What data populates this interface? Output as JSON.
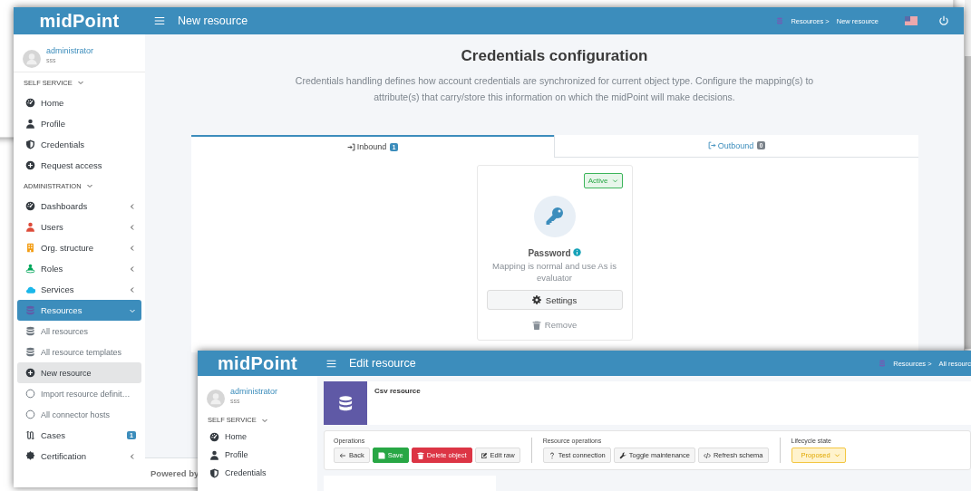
{
  "main_window": {
    "logo": "midPoint",
    "title": "New resource",
    "breadcrumb": {
      "parent": "Resources >",
      "current": "New resource"
    },
    "sidebar": {
      "user": {
        "name": "administrator",
        "subtitle": "sss"
      },
      "sections": [
        {
          "title": "SELF SERVICE",
          "expanded": true,
          "items": [
            {
              "label": "Home",
              "selected": false
            },
            {
              "label": "Profile",
              "selected": false
            },
            {
              "label": "Credentials",
              "selected": false
            },
            {
              "label": "Request access",
              "selected": false
            }
          ]
        },
        {
          "title": "ADMINISTRATION",
          "expanded": true,
          "items": [
            {
              "label": "Dashboards",
              "selected": false,
              "expanded": false
            },
            {
              "label": "Users",
              "selected": false,
              "expanded": false
            },
            {
              "label": "Org. structure",
              "selected": false,
              "expanded": false
            },
            {
              "label": "Roles",
              "selected": false,
              "expanded": false
            },
            {
              "label": "Services",
              "selected": false,
              "expanded": false
            },
            {
              "label": "Resources",
              "selected": true,
              "expanded": true,
              "children": [
                {
                  "label": "All resources",
                  "selected": false
                },
                {
                  "label": "All resource templates",
                  "selected": false
                },
                {
                  "label": "New resource",
                  "selected": true
                },
                {
                  "label": "Import resource definit…",
                  "selected": false
                },
                {
                  "label": "All connector hosts",
                  "selected": false
                }
              ]
            },
            {
              "label": "Cases",
              "selected": false,
              "badge": "1"
            },
            {
              "label": "Certification",
              "selected": false,
              "expanded": false
            }
          ]
        }
      ]
    },
    "heading": "Credentials configuration",
    "description": "Credentials handling defines how account credentials are synchronized for current object type. Configure the mapping(s) to attribute(s) that carry/store this information on which the midPoint will make decisions.",
    "tabs": [
      {
        "label": "Inbound",
        "count": "1",
        "selected": true
      },
      {
        "label": "Outbound",
        "count": "0",
        "selected": false
      }
    ],
    "mapping_card": {
      "status": "Active",
      "name": "Password",
      "description": "Mapping is normal and use As is evaluator",
      "settings_button": "Settings",
      "remove_button": "Remove"
    },
    "footer": "Powered by"
  },
  "front_window": {
    "logo": "midPoint",
    "title": "Edit resource",
    "breadcrumb": {
      "parent": "Resources >",
      "current": "All resourc"
    },
    "sidebar": {
      "user": {
        "name": "administrator",
        "subtitle": "sss"
      },
      "sections": [
        {
          "title": "SELF SERVICE",
          "expanded": true,
          "items": [
            {
              "label": "Home",
              "selected": false
            },
            {
              "label": "Profile",
              "selected": false
            },
            {
              "label": "Credentials",
              "selected": false
            }
          ]
        }
      ]
    },
    "resource": {
      "name": "Csv resource"
    },
    "operation_groups": [
      {
        "label": "Operations",
        "buttons": [
          {
            "label": "Back",
            "kind": "default"
          },
          {
            "label": "Save",
            "kind": "success"
          },
          {
            "label": "Delete object",
            "kind": "danger"
          },
          {
            "label": "Edit raw",
            "kind": "default"
          }
        ]
      },
      {
        "label": "Resource operations",
        "buttons": [
          {
            "label": "Test connection",
            "kind": "default"
          },
          {
            "label": "Toggle maintenance",
            "kind": "default"
          },
          {
            "label": "Refresh schema",
            "kind": "default"
          }
        ]
      }
    ],
    "lifecycle": {
      "label": "Lifecycle state",
      "value": "Proposed"
    }
  }
}
